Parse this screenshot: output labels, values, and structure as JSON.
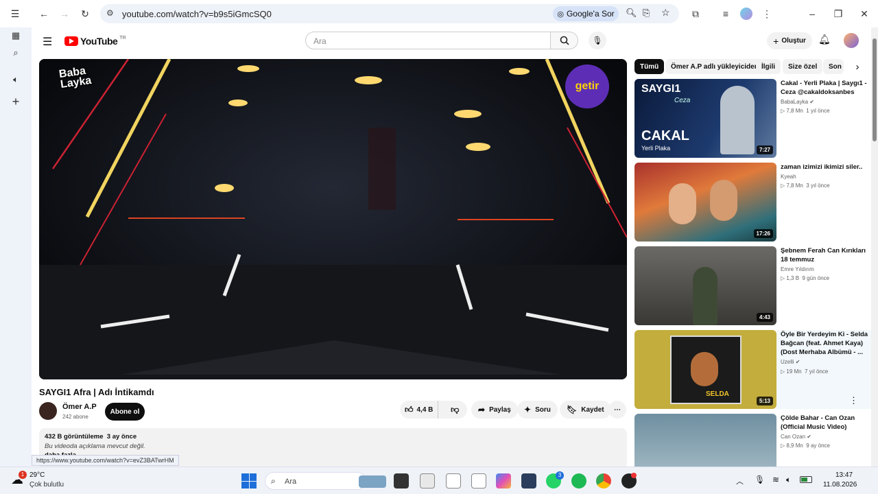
{
  "browser": {
    "url": "youtube.com/watch?v=b9s5iGmcSQ0",
    "google_ask": "Google'a Sor",
    "status_url": "https://www.youtube.com/watch?v=evZ3BATwrHM"
  },
  "youtube": {
    "logo_text": "YouTube",
    "logo_tm": "TR",
    "search_placeholder": "Ara",
    "create_label": "Oluştur",
    "video_overlay": {
      "logo_left_line1": "Baba",
      "logo_left_line2": "Layka",
      "logo_right": "getir"
    },
    "video_title": "SAYGI1 Afra | Adı İntikamdı",
    "channel_name": "Ömer A.P",
    "subscribers": "242 abone",
    "subscribe_label": "Abone ol",
    "likes": "4,4 B",
    "share_label": "Paylaş",
    "ask_label": "Soru",
    "save_label": "Kaydet",
    "views_line": "432 B görüntüleme  3 ay önce",
    "description": "Bu videoda açıklama mevcut değil.",
    "more_label": "daha fazla",
    "chips": [
      "Tümü",
      "Ömer A.P adlı yükleyiciden",
      "İlgili",
      "Size özel",
      "Son"
    ],
    "recommendations": [
      {
        "title": "Cakal - Yerli Plaka | Saygı1 - Ceza @cakaldoksanbes",
        "channel": "BabaLayka",
        "meta": "7,8 Mn  1 yıl önce",
        "duration": "7:27",
        "thumb_text_1": "SAYGI1",
        "thumb_text_2": "Ceza",
        "thumb_text_3": "CAKAL",
        "thumb_text_4": "Yerli Plaka"
      },
      {
        "title": "zaman izimizi ikimizi siler..",
        "channel": "Kyeah",
        "meta": "7,8 Mn  3 yıl önce",
        "duration": "17:26"
      },
      {
        "title": "Şebnem Ferah Can Kırıkları 18 temmuz",
        "channel": "Emre Yıldırım",
        "meta": "1,3 B  9 gün önce",
        "duration": "4:43"
      },
      {
        "title": "Öyle Bir Yerdeyim Ki - Selda Bağcan (feat. Ahmet Kaya) (Dost Merhaba Albümü - ...",
        "channel": "Uzelli",
        "meta": "19 Mn  7 yıl önce",
        "duration": "5:13",
        "thumb_text_1": "SELDA"
      },
      {
        "title": "Çölde Bahar - Can Ozan (Official Music Video)",
        "channel": "Can Ozan",
        "meta": "8,9 Mn  9 ay önce"
      }
    ]
  },
  "taskbar": {
    "temperature": "29°C",
    "weather": "Çok bulutlu",
    "search_label": "Ara",
    "time": "13:47",
    "date": "11.08.2026",
    "weather_badge": "1",
    "whatsapp_badge": "3"
  }
}
